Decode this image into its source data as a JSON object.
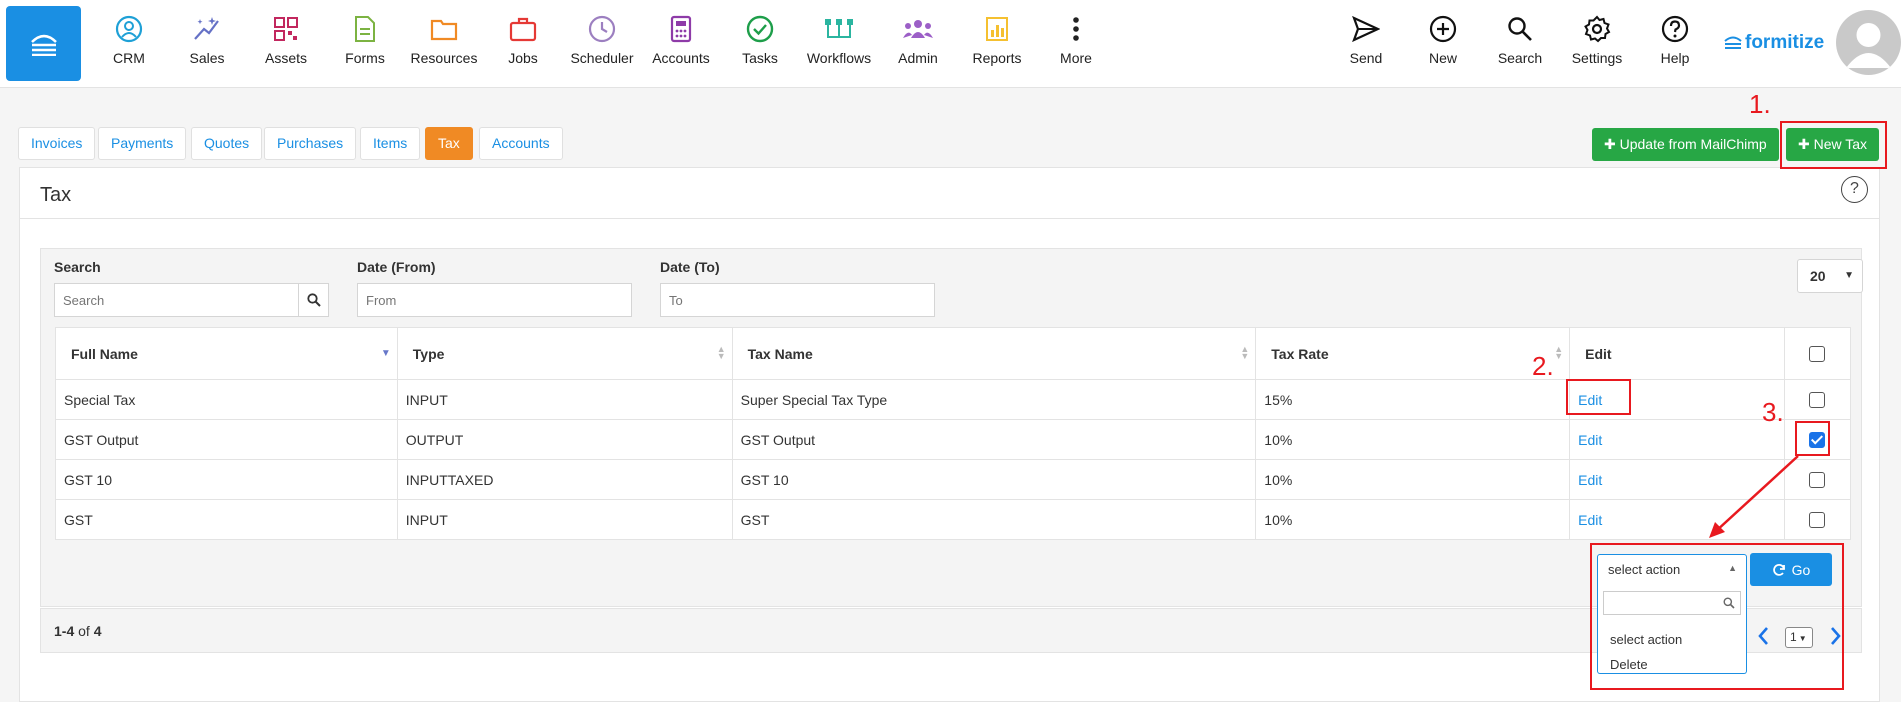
{
  "nav": {
    "items": [
      {
        "label": "CRM",
        "icon": "crm-icon",
        "color": "#1ea0d6"
      },
      {
        "label": "Sales",
        "icon": "sparkle-icon",
        "color": "#6571c6"
      },
      {
        "label": "Assets",
        "icon": "qr-icon",
        "color": "#c2275e"
      },
      {
        "label": "Forms",
        "icon": "document-icon",
        "color": "#7cb342"
      },
      {
        "label": "Resources",
        "icon": "folder-icon",
        "color": "#f08a24"
      },
      {
        "label": "Jobs",
        "icon": "briefcase-icon",
        "color": "#e53935"
      },
      {
        "label": "Scheduler",
        "icon": "clock-icon",
        "color": "#9c7fc0"
      },
      {
        "label": "Accounts",
        "icon": "calculator-icon",
        "color": "#8e3ba8"
      },
      {
        "label": "Tasks",
        "icon": "check-circle-icon",
        "color": "#1e9e4a"
      },
      {
        "label": "Workflows",
        "icon": "workflow-icon",
        "color": "#2bb5a0"
      },
      {
        "label": "Admin",
        "icon": "users-icon",
        "color": "#9c5fc7"
      },
      {
        "label": "Reports",
        "icon": "chart-icon",
        "color": "#f5c030"
      },
      {
        "label": "More",
        "icon": "more-icon",
        "color": "#222222"
      }
    ],
    "right": [
      {
        "label": "Send",
        "icon": "send-icon"
      },
      {
        "label": "New",
        "icon": "plus-circle-icon"
      },
      {
        "label": "Search",
        "icon": "search-icon"
      },
      {
        "label": "Settings",
        "icon": "gear-icon"
      },
      {
        "label": "Help",
        "icon": "help-icon"
      }
    ],
    "brand": "formitize"
  },
  "tabs": [
    "Invoices",
    "Payments",
    "Quotes",
    "Purchases",
    "Items",
    "Tax",
    "Accounts"
  ],
  "active_tab": "Tax",
  "actions": {
    "update_mailchimp": "Update from MailChimp",
    "new_tax": "New Tax"
  },
  "panel": {
    "title": "Tax",
    "help": "?"
  },
  "filters": {
    "search_label": "Search",
    "search_placeholder": "Search",
    "date_from_label": "Date (From)",
    "date_from_placeholder": "From",
    "date_to_label": "Date (To)",
    "date_to_placeholder": "To",
    "per_page": "20"
  },
  "table": {
    "columns": [
      "Full Name",
      "Type",
      "Tax Name",
      "Tax Rate",
      "Edit"
    ],
    "rows": [
      {
        "full_name": "Special Tax",
        "type": "INPUT",
        "tax_name": "Super Special Tax Type",
        "tax_rate": "15%",
        "edit": "Edit",
        "checked": false
      },
      {
        "full_name": "GST Output",
        "type": "OUTPUT",
        "tax_name": "GST Output",
        "tax_rate": "10%",
        "edit": "Edit",
        "checked": true
      },
      {
        "full_name": "GST 10",
        "type": "INPUTTAXED",
        "tax_name": "GST 10",
        "tax_rate": "10%",
        "edit": "Edit",
        "checked": false
      },
      {
        "full_name": "GST",
        "type": "INPUT",
        "tax_name": "GST",
        "tax_rate": "10%",
        "edit": "Edit",
        "checked": false
      }
    ]
  },
  "bulk": {
    "select_value": "select action",
    "options": [
      "select action",
      "Delete"
    ],
    "go_label": "Go"
  },
  "pagination": {
    "range": "1-4",
    "of_label": "of",
    "total": "4",
    "page": "1"
  },
  "annotations": [
    "1.",
    "2.",
    "3."
  ],
  "colors": {
    "primary": "#1a8fe3",
    "active_tab": "#f08a24",
    "green": "#27a745",
    "annotation": "#e8191f"
  }
}
